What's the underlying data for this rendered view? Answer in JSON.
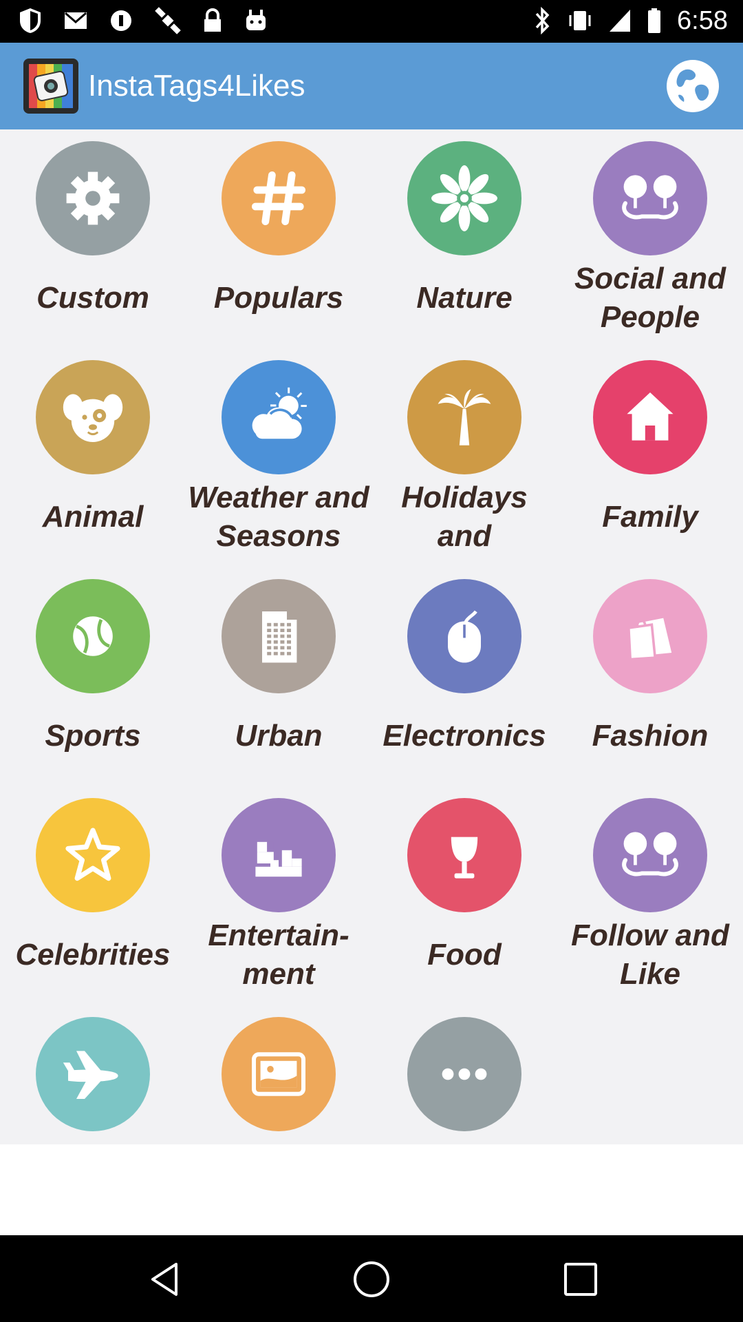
{
  "status_bar": {
    "time": "6:58"
  },
  "app": {
    "title": "InstaTags4Likes"
  },
  "categories": [
    {
      "label": "Custom",
      "color": "#95a0a3",
      "icon": "gear-icon"
    },
    {
      "label": "Populars",
      "color": "#eea85a",
      "icon": "hashtag-icon"
    },
    {
      "label": "Nature",
      "color": "#5cb17f",
      "icon": "flower-icon"
    },
    {
      "label": "Social and People",
      "color": "#9a7dbf",
      "icon": "people-icon"
    },
    {
      "label": "Animal",
      "color": "#c9a457",
      "icon": "dog-icon"
    },
    {
      "label": "Weather and Seasons",
      "color": "#4c91d8",
      "icon": "weather-icon"
    },
    {
      "label": "Holidays and",
      "color": "#ce9a45",
      "icon": "palm-tree-icon"
    },
    {
      "label": "Family",
      "color": "#e5416b",
      "icon": "house-icon"
    },
    {
      "label": "Sports",
      "color": "#7bbd5a",
      "icon": "ball-icon"
    },
    {
      "label": "Urban",
      "color": "#ada29a",
      "icon": "building-icon"
    },
    {
      "label": "Electronics",
      "color": "#6c7bbf",
      "icon": "mouse-icon"
    },
    {
      "label": "Fashion",
      "color": "#eda2c8",
      "icon": "shopping-bag-icon"
    },
    {
      "label": "Celebrities",
      "color": "#f7c53d",
      "icon": "star-icon"
    },
    {
      "label": "Entertain-\nment",
      "color": "#9a7dbf",
      "icon": "blocks-icon"
    },
    {
      "label": "Food",
      "color": "#e4536a",
      "icon": "goblet-icon"
    },
    {
      "label": "Follow and Like",
      "color": "#9a7dbf",
      "icon": "people-icon"
    },
    {
      "label": "",
      "color": "#7cc5c5",
      "icon": "airplane-icon"
    },
    {
      "label": "",
      "color": "#eea85a",
      "icon": "picture-icon"
    },
    {
      "label": "",
      "color": "#95a0a3",
      "icon": "more-icon"
    }
  ]
}
